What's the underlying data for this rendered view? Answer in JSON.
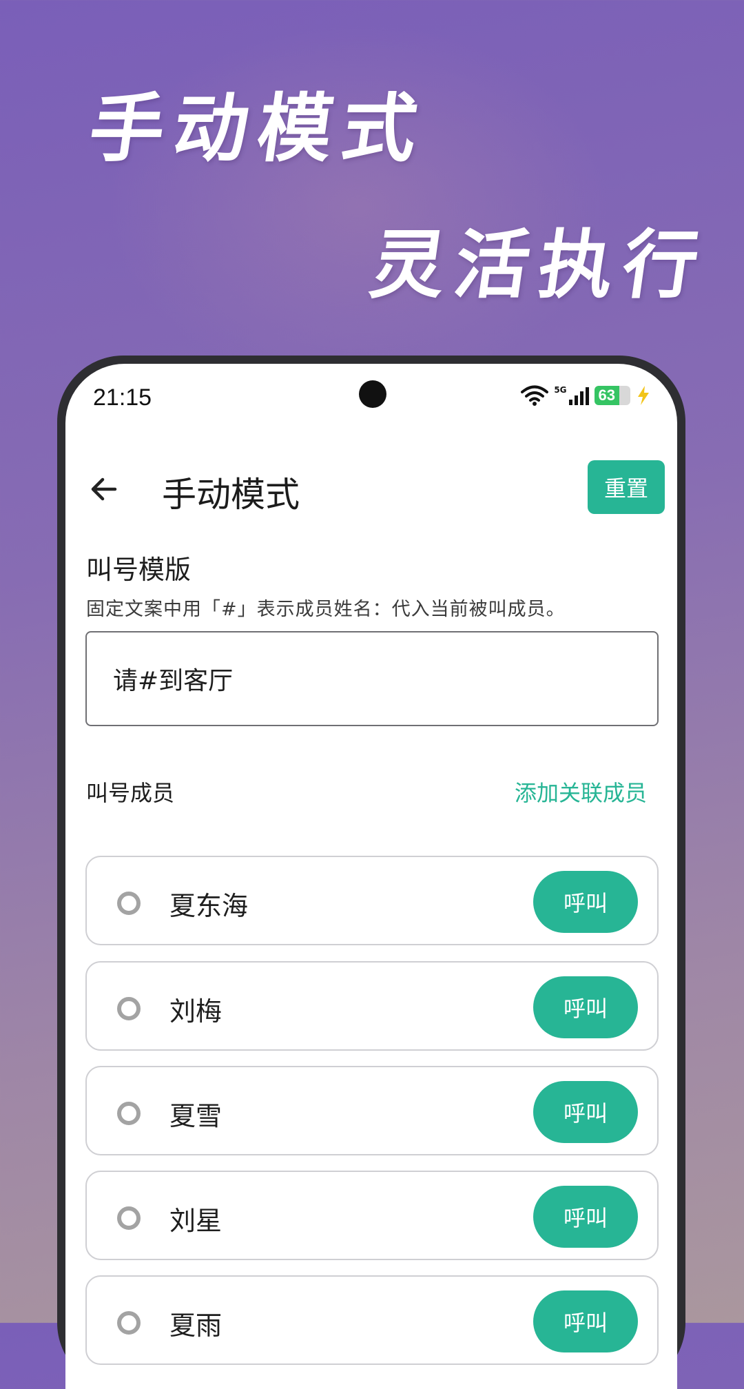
{
  "hero": {
    "line1": "手动模式",
    "line2": "灵活执行"
  },
  "status_bar": {
    "time": "21:15",
    "network": "5G",
    "battery": "63"
  },
  "appbar": {
    "title": "手动模式",
    "reset_label": "重置"
  },
  "template": {
    "heading": "叫号模版",
    "hint": "固定文案中用「#」表示成员姓名：代入当前被叫成员。",
    "value": "请#到客厅"
  },
  "members": {
    "heading": "叫号成员",
    "add_label": "添加关联成员",
    "items": [
      {
        "name": "夏东海",
        "call_label": "呼叫"
      },
      {
        "name": "刘梅",
        "call_label": "呼叫"
      },
      {
        "name": "夏雪",
        "call_label": "呼叫"
      },
      {
        "name": "刘星",
        "call_label": "呼叫"
      },
      {
        "name": "夏雨",
        "call_label": "呼叫"
      }
    ]
  },
  "colors": {
    "accent": "#27b595",
    "background_top": "#7a5fb8",
    "battery": "#35c463"
  }
}
